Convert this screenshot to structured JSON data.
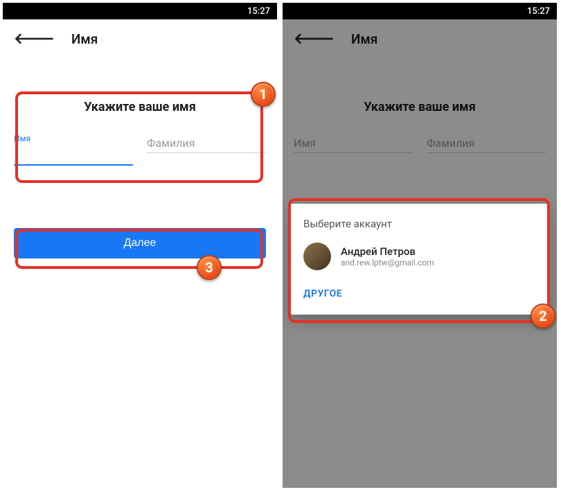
{
  "status_time": "15:27",
  "left": {
    "app_title": "Имя",
    "heading": "Укажите ваше имя",
    "first_name_label": "Имя",
    "last_name_placeholder": "Фамилия",
    "button_label": "Далее"
  },
  "right": {
    "app_title": "Имя",
    "heading": "Укажите ваше имя",
    "first_name_placeholder": "Имя",
    "last_name_placeholder": "Фамилия",
    "modal": {
      "title": "Выберите аккаунт",
      "account_name": "Андрей Петров",
      "account_email": "and.rew.lptw@gmail.com",
      "other_label": "ДРУГОЕ"
    }
  },
  "badges": {
    "one": "1",
    "two": "2",
    "three": "3"
  }
}
